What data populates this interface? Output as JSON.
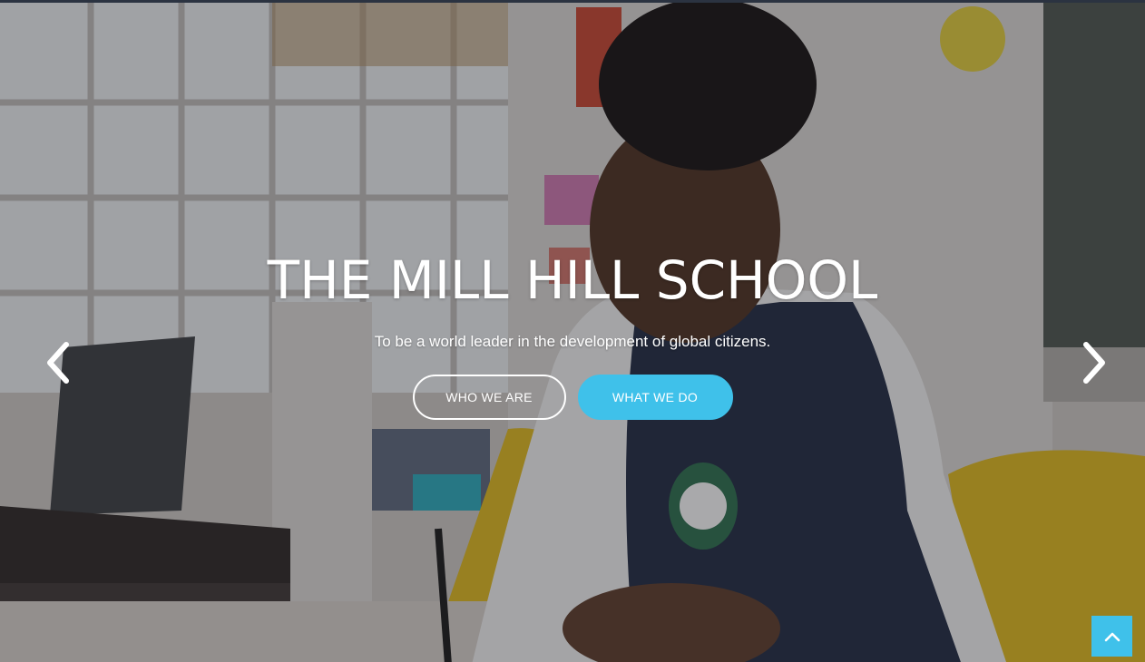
{
  "hero": {
    "title": "THE MILL HILL SCHOOL",
    "subtitle": "To be a world leader in the development of global citizens.",
    "buttons": [
      {
        "label": "WHO WE ARE",
        "style": "outline"
      },
      {
        "label": "WHAT WE DO",
        "style": "filled"
      }
    ],
    "prev_icon": "chevron-left-icon",
    "next_icon": "chevron-right-icon"
  },
  "back_to_top": {
    "icon": "chevron-up-icon"
  },
  "colors": {
    "accent": "#3fc1ea",
    "text": "#ffffff",
    "top_border": "#2b3341"
  }
}
